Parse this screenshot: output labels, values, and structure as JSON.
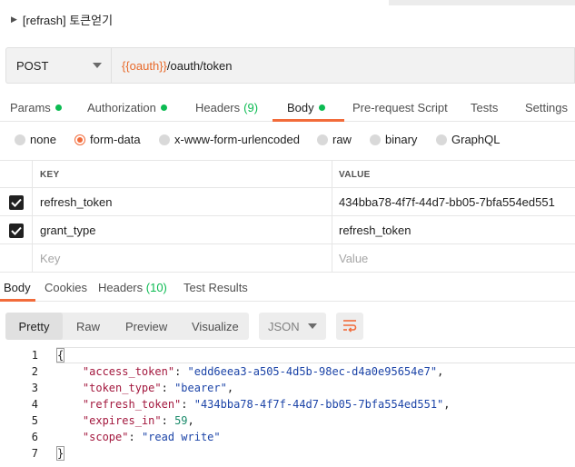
{
  "request": {
    "title": "[refrash] 토큰얻기",
    "method": "POST",
    "url_variable": "{{oauth}}",
    "url_path": "/oauth/token"
  },
  "request_tabs": [
    {
      "label": "Params",
      "dot": true
    },
    {
      "label": "Authorization",
      "dot": true
    },
    {
      "label": "Headers",
      "count": "(9)"
    },
    {
      "label": "Body",
      "dot": true,
      "active": true
    },
    {
      "label": "Pre-request Script"
    },
    {
      "label": "Tests"
    },
    {
      "label": "Settings"
    }
  ],
  "body_types": [
    {
      "label": "none",
      "checked": false
    },
    {
      "label": "form-data",
      "checked": true
    },
    {
      "label": "x-www-form-urlencoded",
      "checked": false
    },
    {
      "label": "raw",
      "checked": false
    },
    {
      "label": "binary",
      "checked": false
    },
    {
      "label": "GraphQL",
      "checked": false
    }
  ],
  "kv_table": {
    "headers": {
      "key": "KEY",
      "value": "VALUE"
    },
    "rows": [
      {
        "checked": true,
        "key": "refresh_token",
        "value": "434bba78-4f7f-44d7-bb05-7bfa554ed551"
      },
      {
        "checked": true,
        "key": "grant_type",
        "value": "refresh_token"
      }
    ],
    "placeholder": {
      "key": "Key",
      "value": "Value"
    }
  },
  "response_tabs": [
    {
      "label": "Body",
      "active": true
    },
    {
      "label": "Cookies"
    },
    {
      "label": "Headers",
      "count": "(10)"
    },
    {
      "label": "Test Results"
    }
  ],
  "response_toolbar": {
    "views": [
      "Pretty",
      "Raw",
      "Preview",
      "Visualize"
    ],
    "active_view": "Pretty",
    "language": "JSON"
  },
  "response_code": [
    {
      "line": "1",
      "parts": [
        {
          "t": "{",
          "c": "brace"
        }
      ]
    },
    {
      "line": "2",
      "parts": [
        {
          "t": "    ",
          "c": "p"
        },
        {
          "t": "\"access_token\"",
          "c": "k"
        },
        {
          "t": ": ",
          "c": "p"
        },
        {
          "t": "\"edd6eea3-a505-4d5b-98ec-d4a0e95654e7\"",
          "c": "s"
        },
        {
          "t": ",",
          "c": "p"
        }
      ]
    },
    {
      "line": "3",
      "parts": [
        {
          "t": "    ",
          "c": "p"
        },
        {
          "t": "\"token_type\"",
          "c": "k"
        },
        {
          "t": ": ",
          "c": "p"
        },
        {
          "t": "\"bearer\"",
          "c": "s"
        },
        {
          "t": ",",
          "c": "p"
        }
      ]
    },
    {
      "line": "4",
      "parts": [
        {
          "t": "    ",
          "c": "p"
        },
        {
          "t": "\"refresh_token\"",
          "c": "k"
        },
        {
          "t": ": ",
          "c": "p"
        },
        {
          "t": "\"434bba78-4f7f-44d7-bb05-7bfa554ed551\"",
          "c": "s"
        },
        {
          "t": ",",
          "c": "p"
        }
      ]
    },
    {
      "line": "5",
      "parts": [
        {
          "t": "    ",
          "c": "p"
        },
        {
          "t": "\"expires_in\"",
          "c": "k"
        },
        {
          "t": ": ",
          "c": "p"
        },
        {
          "t": "59",
          "c": "n"
        },
        {
          "t": ",",
          "c": "p"
        }
      ]
    },
    {
      "line": "6",
      "parts": [
        {
          "t": "    ",
          "c": "p"
        },
        {
          "t": "\"scope\"",
          "c": "k"
        },
        {
          "t": ": ",
          "c": "p"
        },
        {
          "t": "\"read write\"",
          "c": "s"
        }
      ]
    },
    {
      "line": "7",
      "parts": [
        {
          "t": "}",
          "c": "brace"
        }
      ]
    }
  ],
  "colors": {
    "accent": "#f26b3a",
    "status_green": "#0cbb52",
    "url_variable": "#e86a2b",
    "json_key": "#a3183e",
    "json_string": "#1d45a8",
    "json_number": "#198a6a"
  }
}
